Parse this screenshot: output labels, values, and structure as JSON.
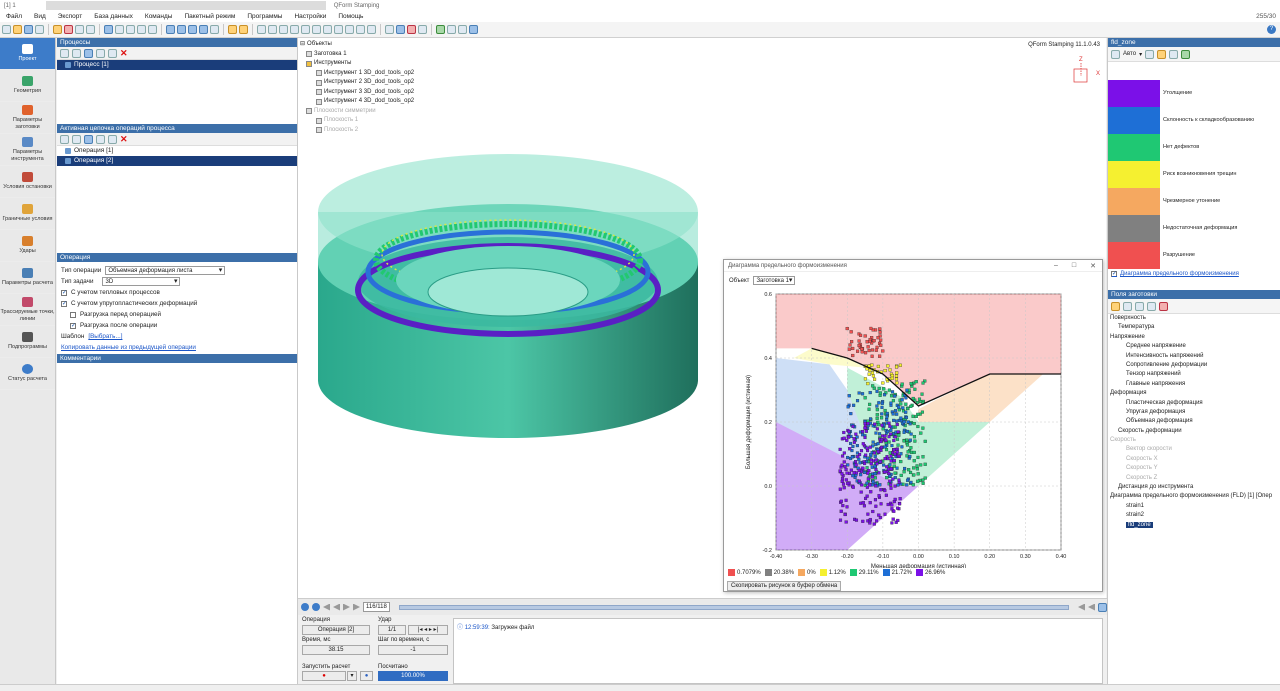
{
  "window": {
    "sys_left": "[1] 1",
    "title": "QForm Stamping",
    "right_readout": "255/30"
  },
  "menu": [
    "Файл",
    "Вид",
    "Экспорт",
    "База данных",
    "Команды",
    "Пакетный режим",
    "Программы",
    "Настройки",
    "Помощь"
  ],
  "left_nav": [
    {
      "label": "Проект",
      "icon": "project-icon",
      "active": true
    },
    {
      "label": "Геометрия",
      "icon": "geometry-icon"
    },
    {
      "label": "Параметры заготовки",
      "icon": "blank-params-icon"
    },
    {
      "label": "Параметры инструмента",
      "icon": "tool-params-icon"
    },
    {
      "label": "Условия остановки",
      "icon": "stop-conditions-icon"
    },
    {
      "label": "Граничные условия",
      "icon": "boundary-icon"
    },
    {
      "label": "Удары",
      "icon": "blows-icon"
    },
    {
      "label": "Параметры расчета",
      "icon": "calc-params-icon"
    },
    {
      "label": "Трассируемые точки, линии",
      "icon": "tracking-icon"
    },
    {
      "label": "Подпрограммы",
      "icon": "subroutines-icon"
    },
    {
      "label": "Статус расчета",
      "icon": "status-icon"
    }
  ],
  "processes": {
    "header": "Процессы",
    "items": [
      "Процесс [1]"
    ]
  },
  "chain": {
    "header": "Активная цепочка операций процесса",
    "items": [
      "Операция [1]",
      "Операция [2]"
    ]
  },
  "operation": {
    "header": "Операция",
    "type_label": "Тип операции",
    "type_value": "Объемная деформация листа",
    "task_label": "Тип задачи",
    "task_value": "3D",
    "cb_thermal": "С учетом тепловых процессов",
    "cb_elastoplastic": "С учетом упругопластических деформаций",
    "cb_unload_before": "Разгрузка перед операцией",
    "cb_unload_after": "Разгрузка после операции",
    "template_label": "Шаблон",
    "template_link": "[Выбрать...]",
    "copy_link": "Копировать данные из предыдущей операции",
    "comments_header": "Комментарии"
  },
  "objects": {
    "root": "Объекты",
    "blank": "Заготовка 1",
    "tools_group": "Инструменты",
    "tools": [
      "Инструмент 1 3D_dod_tools_op2",
      "Инструмент 2 3D_dod_tools_op2",
      "Инструмент 3 3D_dod_tools_op2",
      "Инструмент 4 3D_dod_tools_op2"
    ],
    "sym_group": "Плоскости симметрии",
    "planes": [
      "Плоскость 1",
      "Плоскость 2"
    ]
  },
  "viewport": {
    "version": "QForm Stamping 11.1.0.43",
    "axis_z": "Z",
    "axis_x": "X"
  },
  "fld": {
    "window_title": "Диаграмма предельного формоизменения",
    "object_label": "Объект",
    "object_value": "Заготовка 1",
    "copy_button": "Скопировать рисунок в буфер обмена",
    "legend": [
      {
        "label": "0.7079%",
        "color": "#f05050"
      },
      {
        "label": "20.38%",
        "color": "#808080"
      },
      {
        "label": "0%",
        "color": "#f5a860"
      },
      {
        "label": "1.12%",
        "color": "#f5f030"
      },
      {
        "label": "29.11%",
        "color": "#1fc873"
      },
      {
        "label": "21.72%",
        "color": "#1e6fd6"
      },
      {
        "label": "26.96%",
        "color": "#7b10e8"
      }
    ]
  },
  "chart_data": {
    "type": "scatter",
    "title": "",
    "xlabel": "Меньшая деформация (истинная)",
    "ylabel": "Большая деформация (истинная)",
    "xlim": [
      -0.4,
      0.4
    ],
    "ylim": [
      -0.2,
      0.6
    ],
    "xticks": [
      "-0.40",
      "-0.30",
      "-0.20",
      "-0.10",
      "0.00",
      "0.10",
      "0.20",
      "0.30",
      "0.40"
    ],
    "yticks": [
      "-0.2",
      "0.0",
      "0.2",
      "0.4",
      "0.6"
    ],
    "grid": true,
    "flc_curve": {
      "x": [
        -0.3,
        -0.2,
        -0.1,
        0.0,
        0.2,
        0.4
      ],
      "y": [
        0.43,
        0.4,
        0.35,
        0.25,
        0.35,
        0.35
      ]
    },
    "series": [
      {
        "name": "Разрушение",
        "color": "#f05050",
        "x_range": [
          -0.2,
          -0.1
        ],
        "y_range": [
          0.4,
          0.5
        ]
      },
      {
        "name": "Риск возникновения трещин",
        "color": "#f5f030",
        "x_range": [
          -0.15,
          -0.05
        ],
        "y_range": [
          0.32,
          0.38
        ]
      },
      {
        "name": "Нет дефектов",
        "color": "#1fc873",
        "x_range": [
          -0.15,
          0.02
        ],
        "y_range": [
          0.0,
          0.33
        ]
      },
      {
        "name": "Склонность к складкообразованию",
        "color": "#1e6fd6",
        "x_range": [
          -0.2,
          -0.02
        ],
        "y_range": [
          0.0,
          0.3
        ]
      },
      {
        "name": "Утолщение",
        "color": "#7b10e8",
        "x_range": [
          -0.22,
          -0.05
        ],
        "y_range": [
          -0.12,
          0.2
        ]
      }
    ]
  },
  "fld_zone": {
    "header": "fld_zone",
    "mode": "Авто",
    "zones": [
      {
        "label": "Утолщение",
        "color": "#7b10e8"
      },
      {
        "label": "Склонность к складкообразованию",
        "color": "#1e6fd6"
      },
      {
        "label": "Нет дефектов",
        "color": "#1fc873"
      },
      {
        "label": "Риск возникновения трещин",
        "color": "#f5f030"
      },
      {
        "label": "Чрезмерное утонение",
        "color": "#f5a860"
      },
      {
        "label": "Недостаточная деформация",
        "color": "#808080"
      },
      {
        "label": "Разрушение",
        "color": "#f05050"
      }
    ],
    "link": "Диаграмма предельного формоизменения"
  },
  "fields": {
    "header": "Поля заготовки",
    "items": [
      {
        "t": "Поверхность",
        "l": 0
      },
      {
        "t": "Температура",
        "l": 1
      },
      {
        "t": "Напряжение",
        "l": 0
      },
      {
        "t": "Среднее напряжение",
        "l": 2
      },
      {
        "t": "Интенсивность напряжений",
        "l": 2
      },
      {
        "t": "Сопротивление деформации",
        "l": 2
      },
      {
        "t": "Тензор напряжений",
        "l": 2
      },
      {
        "t": "Главные напряжения",
        "l": 2
      },
      {
        "t": "Деформация",
        "l": 0
      },
      {
        "t": "Пластическая деформация",
        "l": 2
      },
      {
        "t": "Упругая деформация",
        "l": 2
      },
      {
        "t": "Объемная деформация",
        "l": 2
      },
      {
        "t": "Скорость деформации",
        "l": 1
      },
      {
        "t": "Скорость",
        "l": 0,
        "dim": true
      },
      {
        "t": "Вектор скорости",
        "l": 2,
        "dim": true
      },
      {
        "t": "Скорость X",
        "l": 2,
        "dim": true
      },
      {
        "t": "Скорость Y",
        "l": 2,
        "dim": true
      },
      {
        "t": "Скорость Z",
        "l": 2,
        "dim": true
      },
      {
        "t": "Дистанция до инструмента",
        "l": 1
      },
      {
        "t": "Диаграмма предельного формоизменения (FLD) [1] [Опер",
        "l": 0
      },
      {
        "t": "strain1",
        "l": 2
      },
      {
        "t": "strain2",
        "l": 2
      },
      {
        "t": "fld_zone",
        "l": 2,
        "hl": true
      }
    ]
  },
  "playback": {
    "frame": "116/118"
  },
  "info": {
    "op_label": "Операция",
    "op_value": "Операция [2]",
    "blow_label": "Удар",
    "blow_value": "1/1",
    "time_label": "Время, мс",
    "time_value": "38.15",
    "step_label": "Шаг по времени, с",
    "step_value": "-1",
    "run_label": "Запустить расчет",
    "calc_label": "Посчитано",
    "calc_value": "100.00%"
  },
  "log": {
    "time": "12:59:39:",
    "message": "Загружен файл"
  }
}
